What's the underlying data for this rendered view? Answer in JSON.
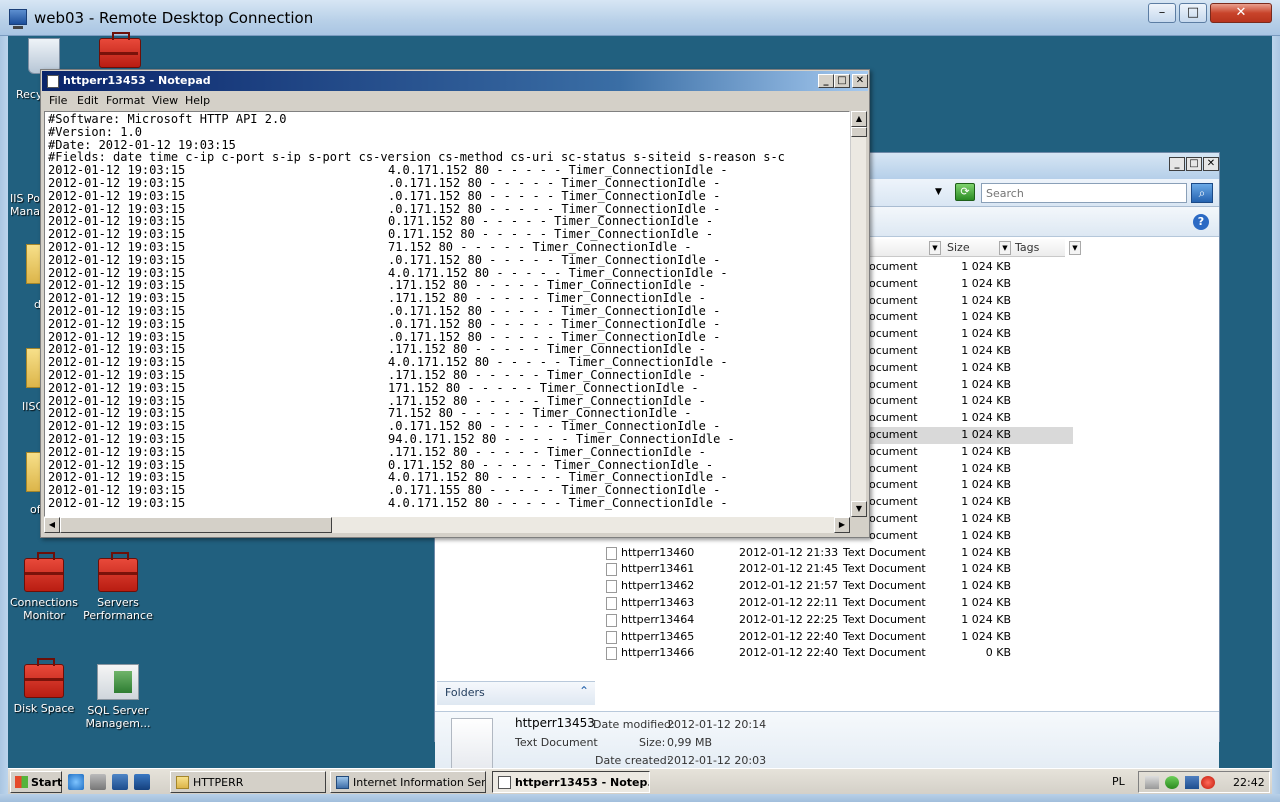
{
  "rdp": {
    "title": "web03 - Remote Desktop Connection",
    "min_glyph": "–",
    "max_glyph": "□",
    "close_glyph": "✕"
  },
  "desktop": {
    "icons": [
      {
        "name": "Connections Monitor",
        "line1": "Connections",
        "line2": "Monitor"
      },
      {
        "name": "Servers Performance",
        "line1": "Servers",
        "line2": "Performance"
      },
      {
        "name": "Disk Space",
        "line1": "Disk Space",
        "line2": ""
      },
      {
        "name": "SQL Server Managem...",
        "line1": "SQL Server",
        "line2": "Managem..."
      }
    ],
    "partial_labels": [
      "Recy",
      "IIS Po",
      "Mana",
      "d",
      "IISC",
      "of"
    ]
  },
  "notepad": {
    "title": "httperr13453 - Notepad",
    "menu": [
      "File",
      "Edit",
      "Format",
      "View",
      "Help"
    ],
    "header_lines": [
      "#Software: Microsoft HTTP API 2.0",
      "#Version: 1.0",
      "#Date: 2012-01-12 19:03:15",
      "#Fields: date time c-ip c-port s-ip s-port cs-version cs-method cs-uri sc-status s-siteid s-reason s-c"
    ],
    "log_lines": [
      {
        "ts": "2012-01-12 19:03:15",
        "rest": "4.0.171.152 80 - - - - - Timer_ConnectionIdle -"
      },
      {
        "ts": "2012-01-12 19:03:15",
        "rest": ".0.171.152 80 - - - - - Timer_ConnectionIdle -"
      },
      {
        "ts": "2012-01-12 19:03:15",
        "rest": ".0.171.152 80 - - - - - Timer_ConnectionIdle -"
      },
      {
        "ts": "2012-01-12 19:03:15",
        "rest": ".0.171.152 80 - - - - - Timer_ConnectionIdle -"
      },
      {
        "ts": "2012-01-12 19:03:15",
        "rest": "0.171.152 80 - - - - - Timer_ConnectionIdle -"
      },
      {
        "ts": "2012-01-12 19:03:15",
        "rest": "0.171.152 80 - - - - - Timer_ConnectionIdle -"
      },
      {
        "ts": "2012-01-12 19:03:15",
        "rest": "71.152 80 - - - - - Timer_ConnectionIdle -"
      },
      {
        "ts": "2012-01-12 19:03:15",
        "rest": ".0.171.152 80 - - - - - Timer_ConnectionIdle -"
      },
      {
        "ts": "2012-01-12 19:03:15",
        "rest": "4.0.171.152 80 - - - - - Timer_ConnectionIdle -"
      },
      {
        "ts": "2012-01-12 19:03:15",
        "rest": ".171.152 80 - - - - - Timer_ConnectionIdle -"
      },
      {
        "ts": "2012-01-12 19:03:15",
        "rest": ".171.152 80 - - - - - Timer_ConnectionIdle -"
      },
      {
        "ts": "2012-01-12 19:03:15",
        "rest": ".0.171.152 80 - - - - - Timer_ConnectionIdle -"
      },
      {
        "ts": "2012-01-12 19:03:15",
        "rest": ".0.171.152 80 - - - - - Timer_ConnectionIdle -"
      },
      {
        "ts": "2012-01-12 19:03:15",
        "rest": ".0.171.152 80 - - - - - Timer_ConnectionIdle -"
      },
      {
        "ts": "2012-01-12 19:03:15",
        "rest": ".171.152 80 - - - - - Timer_ConnectionIdle -"
      },
      {
        "ts": "2012-01-12 19:03:15",
        "rest": "4.0.171.152 80 - - - - - Timer_ConnectionIdle -"
      },
      {
        "ts": "2012-01-12 19:03:15",
        "rest": ".171.152 80 - - - - - Timer_ConnectionIdle -"
      },
      {
        "ts": "2012-01-12 19:03:15",
        "rest": "171.152 80 - - - - - Timer_ConnectionIdle -"
      },
      {
        "ts": "2012-01-12 19:03:15",
        "rest": ".171.152 80 - - - - - Timer_ConnectionIdle -"
      },
      {
        "ts": "2012-01-12 19:03:15",
        "rest": "71.152 80 - - - - - Timer_ConnectionIdle -"
      },
      {
        "ts": "2012-01-12 19:03:15",
        "rest": ".0.171.152 80 - - - - - Timer_ConnectionIdle -"
      },
      {
        "ts": "2012-01-12 19:03:15",
        "rest": "94.0.171.152 80 - - - - - Timer_ConnectionIdle -"
      },
      {
        "ts": "2012-01-12 19:03:15",
        "rest": ".171.152 80 - - - - - Timer_ConnectionIdle -"
      },
      {
        "ts": "2012-01-12 19:03:15",
        "rest": "0.171.152 80 - - - - - Timer_ConnectionIdle -"
      },
      {
        "ts": "2012-01-12 19:03:15",
        "rest": "4.0.171.152 80 - - - - - Timer_ConnectionIdle -"
      },
      {
        "ts": "2012-01-12 19:03:15",
        "rest": ".0.171.155 80 - - - - - Timer_ConnectionIdle -"
      },
      {
        "ts": "2012-01-12 19:03:15",
        "rest": "4.0.171.152 80 - - - - - Timer_ConnectionIdle -"
      }
    ]
  },
  "explorer": {
    "search_placeholder": "Search",
    "columns": {
      "size": "Size",
      "tags": "Tags"
    },
    "type_fragment": "ocument",
    "size_value": "1 024 KB",
    "truncated_rows": 17,
    "selected_index": 10,
    "full_rows": [
      {
        "name": "httperr13460",
        "date": "2012-01-12 21:33",
        "type": "Text Document",
        "size": "1 024 KB"
      },
      {
        "name": "httperr13461",
        "date": "2012-01-12 21:45",
        "type": "Text Document",
        "size": "1 024 KB"
      },
      {
        "name": "httperr13462",
        "date": "2012-01-12 21:57",
        "type": "Text Document",
        "size": "1 024 KB"
      },
      {
        "name": "httperr13463",
        "date": "2012-01-12 22:11",
        "type": "Text Document",
        "size": "1 024 KB"
      },
      {
        "name": "httperr13464",
        "date": "2012-01-12 22:25",
        "type": "Text Document",
        "size": "1 024 KB"
      },
      {
        "name": "httperr13465",
        "date": "2012-01-12 22:40",
        "type": "Text Document",
        "size": "1 024 KB"
      },
      {
        "name": "httperr13466",
        "date": "2012-01-12 22:40",
        "type": "Text Document",
        "size": "0 KB"
      }
    ],
    "folders_label": "Folders",
    "details": {
      "name": "httperr13453",
      "type": "Text Document",
      "modified_label": "Date modified:",
      "modified_value": "2012-01-12 20:14",
      "size_label": "Size:",
      "size_value": "0,99 MB",
      "created_label": "Date created:",
      "created_value": "2012-01-12 20:03"
    }
  },
  "taskbar": {
    "start_label": "Start",
    "tasks": [
      {
        "label": "HTTPERR",
        "active": false
      },
      {
        "label": "Internet Information Ser...",
        "active": false
      },
      {
        "label": "httperr13453 - Notep...",
        "active": true
      }
    ],
    "language": "PL",
    "clock": "22:42"
  }
}
